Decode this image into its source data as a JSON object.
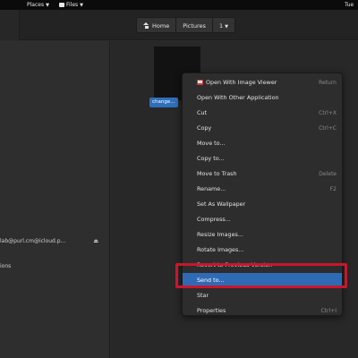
{
  "top_panel": {
    "places_label": "Places",
    "files_label": "Files",
    "clock_label": "Tue"
  },
  "path_bar": {
    "home_label": "Home",
    "pictures_label": "Pictures",
    "current_label": "1"
  },
  "sidebar": {
    "account_label": "lab@purl.cm@icloud.p...",
    "other_locations_label": "ions"
  },
  "file": {
    "name": "change..."
  },
  "context_menu": {
    "items": [
      {
        "label": "Open With Image Viewer",
        "accel": "Return",
        "icon": "image-viewer-icon"
      },
      {
        "label": "Open With Other Application",
        "accel": ""
      },
      {
        "label": "Cut",
        "accel": "Ctrl+X"
      },
      {
        "label": "Copy",
        "accel": "Ctrl+C"
      },
      {
        "label": "Move to...",
        "accel": ""
      },
      {
        "label": "Copy to...",
        "accel": ""
      },
      {
        "label": "Move to Trash",
        "accel": "Delete"
      },
      {
        "label": "Rename...",
        "accel": "F2"
      },
      {
        "label": "Set As Wallpaper",
        "accel": ""
      },
      {
        "label": "Compress...",
        "accel": ""
      },
      {
        "label": "Resize Images...",
        "accel": ""
      },
      {
        "label": "Rotate Images...",
        "accel": ""
      },
      {
        "label": "Revert to Previous Version",
        "accel": ""
      },
      {
        "label": "Send to...",
        "accel": "",
        "selected": true
      },
      {
        "label": "Star",
        "accel": ""
      },
      {
        "label": "Properties",
        "accel": "Ctrl+I"
      }
    ]
  },
  "colors": {
    "selection": "#2f6bb5",
    "highlight_annotation": "#c8172c"
  }
}
